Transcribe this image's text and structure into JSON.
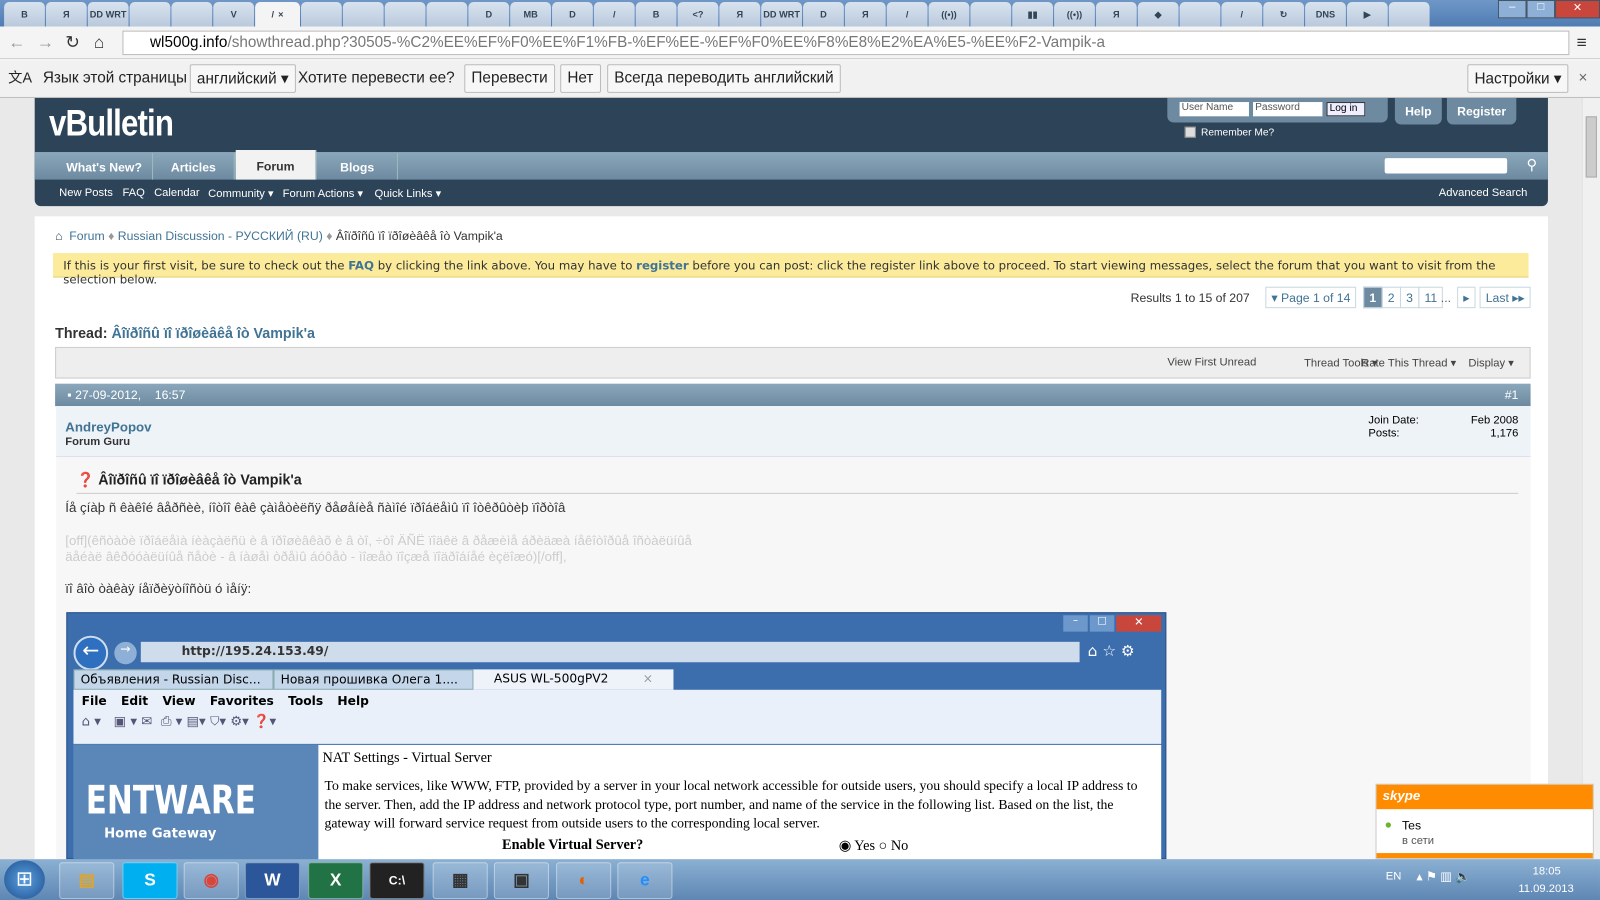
{
  "browser": {
    "tab_icons": [
      "B",
      "Я",
      "DD WRT",
      "",
      "",
      "V",
      "/",
      "",
      "",
      "",
      "",
      "D",
      "MB",
      "D",
      "/",
      "B",
      "<?",
      "Я",
      "DD WRT",
      "D",
      "Я",
      "/",
      "((•))",
      "",
      "▮▮",
      "((•))",
      "Я",
      "◆",
      "",
      "/",
      "↻",
      "DNS",
      "▶",
      ""
    ],
    "active_tab_close": "×",
    "url_host": "wl500g.info",
    "url_path": "/showthread.php?30505-%C2%EE%EF%F0%EE%F1%FB-%EF%EE-%EF%F0%EE%F8%E8%E2%EA%E5-%EE%F2-Vampik-a"
  },
  "translate": {
    "lang_label": "Язык этой страницы",
    "lang_value": "английский",
    "question": "Хотите перевести ее?",
    "translate": "Перевести",
    "no": "Нет",
    "always": "Всегда переводить английский",
    "settings": "Настройки",
    "close": "×"
  },
  "forum": {
    "logo": "vBulletin",
    "username_ph": "User Name",
    "password_ph": "Password",
    "login": "Log in",
    "remember": "Remember Me?",
    "help": "Help",
    "register": "Register",
    "tabs": [
      "What's New?",
      "Articles",
      "Forum",
      "Blogs"
    ],
    "subnav": [
      "New Posts",
      "FAQ",
      "Calendar",
      "Community ▾",
      "Forum Actions ▾",
      "Quick Links ▾"
    ],
    "advanced_search": "Advanced Search",
    "breadcrumb": [
      "Forum",
      "Russian Discussion - РУССКИЙ (RU)",
      "Âîïðîñû ïî ïðîøèâêå îò Vampik'a"
    ],
    "notice": {
      "a": "If this is your first visit, be sure to check out the ",
      "faq": "FAQ",
      "b": " by clicking the link above. You may have to ",
      "register": "register",
      "c": " before you can post: click the register link above to proceed. To start viewing messages, select the forum that you want to visit from the selection below."
    },
    "results": "Results 1 to 15 of 207",
    "page_of": "▾ Page 1 of 14",
    "pages": [
      "1",
      "2",
      "3",
      "11"
    ],
    "ellipsis": "...",
    "next": "▸",
    "last": "Last ▸▸",
    "thread_label": "Thread:",
    "thread_title": "Âîïðîñû ïî ïðîøèâêå îò Vampik'a",
    "tools": {
      "first_unread": "View First Unread",
      "thread_tools": "Thread Tools ▾",
      "rate": "Rate This Thread ▾",
      "display": "Display ▾"
    },
    "post": {
      "date": "27-09-2012,",
      "time": "16:57",
      "num": "#1",
      "author": "AndreyPopov",
      "rank": "Forum Guru",
      "join_label": "Join Date:",
      "join": "Feb 2008",
      "posts_label": "Posts:",
      "posts": "1,176",
      "title": "Âîïðîñû ïî ïðîøèâêå îò Vampik'a",
      "line1": "Íå çíàþ ñ êàêîé âåðñèè, íîòîî êàê çàìåòèëñÿ ðåøåíèå ñàìîé ïðîáëåìû ïî îòêðûòèþ ïîðòîâ",
      "off1": "[off](êñòàòè ïðîáëåìà íèàçàëñü è â ïðîøèâêàõ è â òî, ÷òî ÄÑË ïîäêë â ðåæèìå áðèäæà íåêîòîðûå îñòàëüíûå",
      "off2": "äåéàë âêðóóàëüíûå ñåòè - â íàøåì òðåìû áóôåò - ìîæåò ïîçæå ïîäðîáíåé èçëîæó)[/off],",
      "line2": "ïî âîò òàêàÿ íåïðèÿòíîñòü ó ìåíÿ:"
    }
  },
  "embed": {
    "url": "http://195.24.153.49/",
    "tabs": [
      "Объявления - Russian Disc...",
      "Новая прошивка Олега 1....",
      "ASUS WL-500gPV2"
    ],
    "tab_close": "×",
    "menu": [
      "File",
      "Edit",
      "View",
      "Favorites",
      "Tools",
      "Help"
    ],
    "brand": "ENTWARE",
    "brand_sub": "Home Gateway",
    "heading": "NAT Settings - Virtual Server",
    "desc": "To make services, like WWW, FTP, provided by a server in your local network accessible for outside users, you should specify a local IP address to the server. Then, add the IP address and network protocol type, port number, and name of the service in the following list. Based on the list, the gateway will forward service request from outside users to the corresponding local server.",
    "enable_label": "Enable Virtual Server?",
    "yes": "Yes",
    "no": "No"
  },
  "skype": {
    "logo": "skype",
    "name": "Tes",
    "status": "в сети"
  },
  "taskbar": {
    "lang": "EN",
    "time": "18:05",
    "date": "11.09.2013"
  }
}
